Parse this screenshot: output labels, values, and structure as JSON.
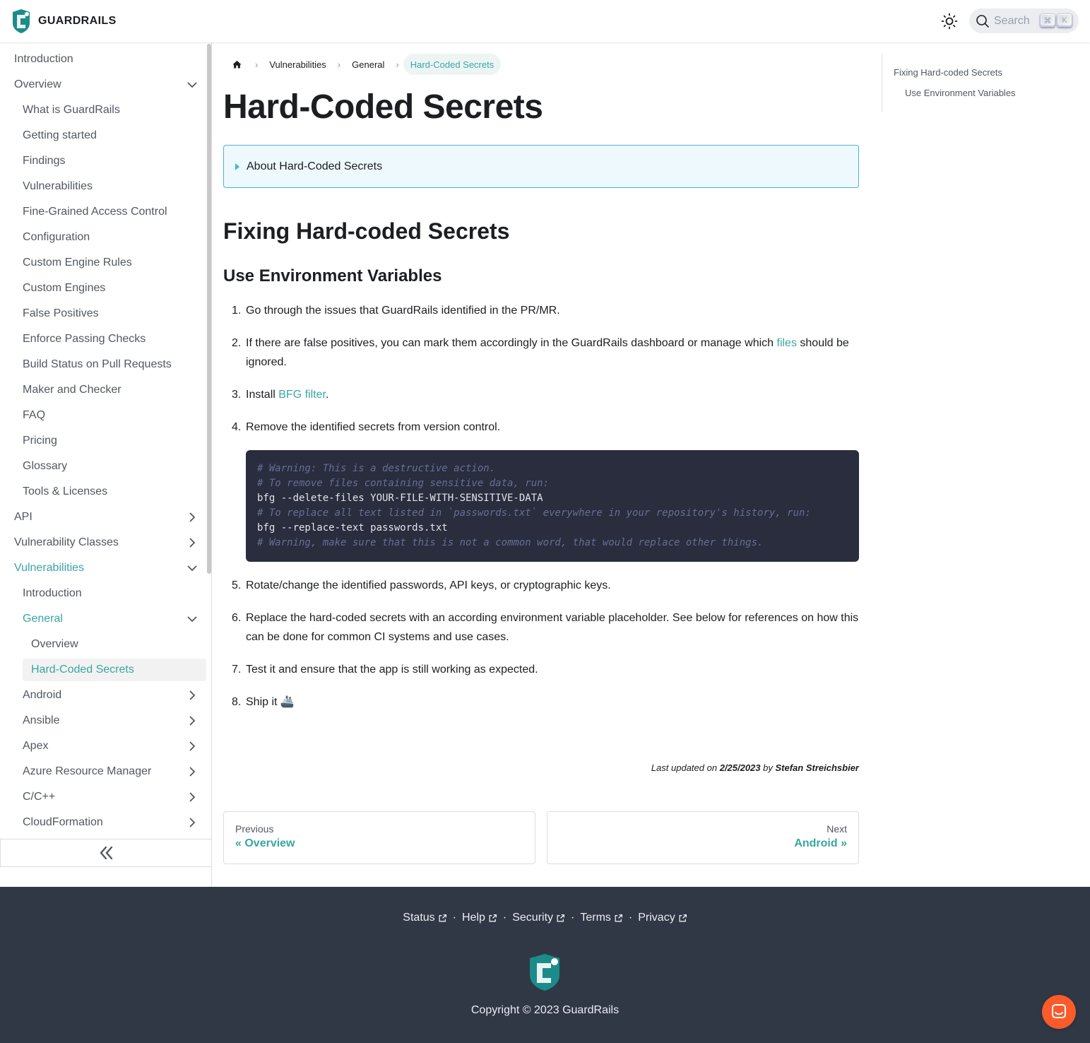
{
  "navbar": {
    "brand": "GUARDRAILS",
    "search_placeholder": "Search",
    "kbd_cmd": "⌘",
    "kbd_k": "K"
  },
  "sidebar": {
    "items": [
      {
        "label": "Introduction"
      },
      {
        "label": "Overview"
      },
      {
        "label": "What is GuardRails"
      },
      {
        "label": "Getting started"
      },
      {
        "label": "Findings"
      },
      {
        "label": "Vulnerabilities"
      },
      {
        "label": "Fine-Grained Access Control"
      },
      {
        "label": "Configuration"
      },
      {
        "label": "Custom Engine Rules"
      },
      {
        "label": "Custom Engines"
      },
      {
        "label": "False Positives"
      },
      {
        "label": "Enforce Passing Checks"
      },
      {
        "label": "Build Status on Pull Requests"
      },
      {
        "label": "Maker and Checker"
      },
      {
        "label": "FAQ"
      },
      {
        "label": "Pricing"
      },
      {
        "label": "Glossary"
      },
      {
        "label": "Tools & Licenses"
      },
      {
        "label": "API"
      },
      {
        "label": "Vulnerability Classes"
      },
      {
        "label": "Vulnerabilities"
      },
      {
        "label": "Introduction"
      },
      {
        "label": "General"
      },
      {
        "label": "Overview"
      },
      {
        "label": "Hard-Coded Secrets"
      },
      {
        "label": "Android"
      },
      {
        "label": "Ansible"
      },
      {
        "label": "Apex"
      },
      {
        "label": "Azure Resource Manager"
      },
      {
        "label": "C/C++"
      },
      {
        "label": "CloudFormation"
      }
    ]
  },
  "breadcrumbs": [
    "Vulnerabilities",
    "General",
    "Hard-Coded Secrets"
  ],
  "page": {
    "title": "Hard-Coded Secrets",
    "details_summary": "About Hard-Coded Secrets",
    "h2": "Fixing Hard-coded Secrets",
    "h3": "Use Environment Variables",
    "steps": {
      "s1": "Go through the issues that GuardRails identified in the PR/MR.",
      "s2_a": "If there are false positives, you can mark them accordingly in the GuardRails dashboard or manage which ",
      "s2_link": "files",
      "s2_b": " should be ignored.",
      "s3_a": "Install ",
      "s3_link": "BFG filter",
      "s3_b": ".",
      "s4": "Remove the identified secrets from version control.",
      "s5": "Rotate/change the identified passwords, API keys, or cryptographic keys.",
      "s6": "Replace the hard-coded secrets with an according environment variable placeholder. See below for references on how this can be done for common CI systems and use cases.",
      "s7": "Test it and ensure that the app is still working as expected.",
      "s8": "Ship it 🚢"
    },
    "code": [
      "# Warning: This is a destructive action.",
      "# To remove files containing sensitive data, run:",
      "bfg --delete-files YOUR-FILE-WITH-SENSITIVE-DATA",
      "# To replace all text listed in `passwords.txt` everywhere in your repository's history, run:",
      "bfg --replace-text passwords.txt",
      "# Warning, make sure that this is not a common word, that would replace other things."
    ],
    "last_updated_prefix": "Last updated on ",
    "last_updated_date": "2/25/2023",
    "last_updated_by": " by ",
    "last_updated_author": "Stefan Streichsbier",
    "prev_sub": "Previous",
    "prev_label": "« Overview",
    "next_sub": "Next",
    "next_label": "Android »"
  },
  "toc": [
    "Fixing Hard-coded Secrets",
    "Use Environment Variables"
  ],
  "footer": {
    "links": [
      "Status",
      "Help",
      "Security",
      "Terms",
      "Privacy"
    ],
    "separator": "·",
    "copyright": "Copyright © 2023 GuardRails"
  },
  "colors": {
    "accent": "#3aa6a1",
    "footer_bg": "#303846",
    "code_bg": "#292d3e",
    "chat": "#f95b2b"
  }
}
